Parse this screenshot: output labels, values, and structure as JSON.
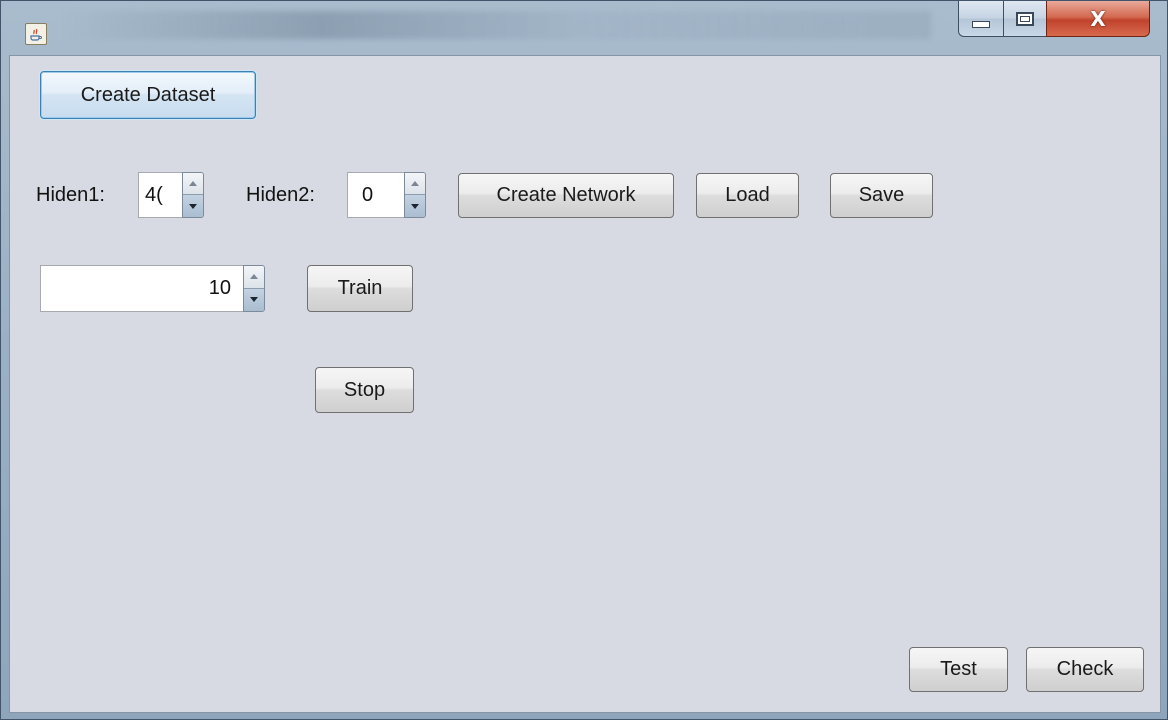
{
  "window": {
    "title": "",
    "controls": {
      "minimize": "minimize",
      "maximize": "maximize",
      "close_glyph": "X"
    }
  },
  "buttons": {
    "create_dataset": "Create Dataset",
    "create_network": "Create Network",
    "load": "Load",
    "save": "Save",
    "train": "Train",
    "stop": "Stop",
    "test": "Test",
    "check": "Check"
  },
  "hidden1": {
    "label": "Hiden1:",
    "value": "4("
  },
  "hidden2": {
    "label": "Hiden2:",
    "value": "0"
  },
  "epochs": {
    "value": "10"
  },
  "icons": {
    "app": "java-coffee-cup-icon",
    "spin_up": "triangle-up-icon",
    "spin_down": "triangle-down-icon"
  }
}
